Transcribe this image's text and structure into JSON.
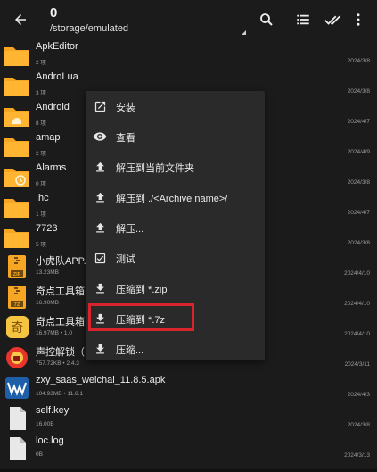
{
  "header": {
    "count": "0",
    "path": "/storage/emulated",
    "icons": [
      "back-arrow-icon",
      "search-icon",
      "list-view-icon",
      "select-all-icon",
      "more-vert-icon"
    ]
  },
  "files": [
    {
      "name": "ApkEditor",
      "meta": "2 项",
      "date": "2024/3/8",
      "icon": "folder"
    },
    {
      "name": "AndroLua",
      "meta": "3 项",
      "date": "2024/3/8",
      "icon": "folder"
    },
    {
      "name": "Android",
      "meta": "8 项",
      "date": "2024/4/7",
      "icon": "folder-android"
    },
    {
      "name": "amap",
      "meta": "2 项",
      "date": "2024/4/9",
      "icon": "folder"
    },
    {
      "name": "Alarms",
      "meta": "0 项",
      "date": "2024/3/8",
      "icon": "folder-alarm"
    },
    {
      "name": ".hc",
      "meta": "1 项",
      "date": "2024/4/7",
      "icon": "folder"
    },
    {
      "name": "7723",
      "meta": "5 项",
      "date": "2024/3/8",
      "icon": "folder"
    },
    {
      "name": "小虎队APP...",
      "meta": "13.23MB",
      "date": "2024/4/10",
      "icon": "zip"
    },
    {
      "name": "奇点工具箱",
      "meta": "16.90MB",
      "date": "2024/4/10",
      "icon": "7z"
    },
    {
      "name": "奇点工具箱（",
      "meta": "16.97MB  •  1.0",
      "date": "2024/4/10",
      "icon": "app-qi"
    },
    {
      "name": "声控解锁（",
      "meta": "757.72KB  •  2.4.3",
      "date": "2024/3/11",
      "icon": "app-lock"
    },
    {
      "name": "zxy_saas_weichai_11.8.5.apk",
      "meta": "104.93MB  •  11.8.1",
      "date": "2024/4/3",
      "icon": "app-w"
    },
    {
      "name": "self.key",
      "meta": "16.00B",
      "date": "2024/3/8",
      "icon": "doc"
    },
    {
      "name": "loc.log",
      "meta": "0B",
      "date": "2024/3/13",
      "icon": "doc"
    }
  ],
  "menu": [
    {
      "label": "安装",
      "icon": "open-external-icon"
    },
    {
      "label": "查看",
      "icon": "eye-icon"
    },
    {
      "label": "解压到当前文件夹",
      "icon": "upload-icon"
    },
    {
      "label": "解压到 ./<Archive name>/",
      "icon": "upload-icon"
    },
    {
      "label": "解压...",
      "icon": "upload-icon"
    },
    {
      "label": "测试",
      "icon": "checkbox-icon"
    },
    {
      "label": "压缩到 *.zip",
      "icon": "download-icon"
    },
    {
      "label": "压缩到 *.7z",
      "icon": "download-icon"
    },
    {
      "label": "压缩...",
      "icon": "download-icon"
    }
  ],
  "colors": {
    "folder": "#f6a623",
    "highlight": "#d8242c",
    "background": "#1b1b1b",
    "menu": "#2a2a2a"
  }
}
